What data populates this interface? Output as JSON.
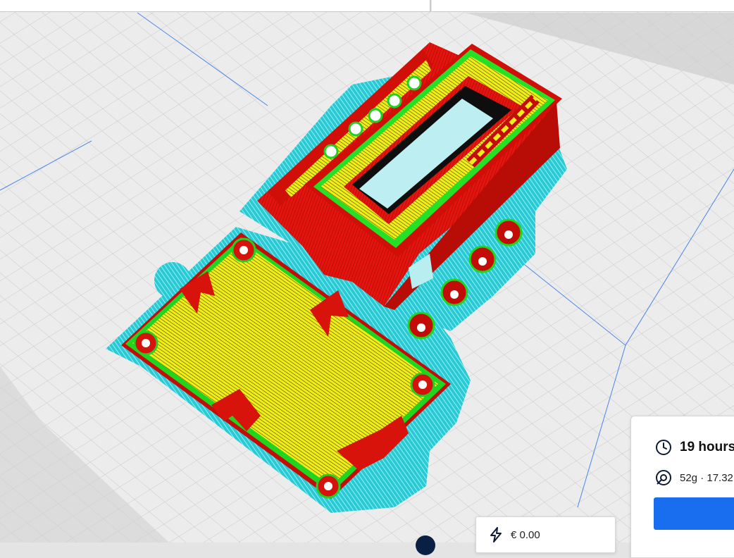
{
  "estimate": {
    "cost": "€ 0.00",
    "print_time": "19 hours",
    "material": "52g · 17.32"
  },
  "slice_button": {
    "label": ""
  },
  "colors": {
    "accent": "#196ef0",
    "plate_grid": "#e4e4e4",
    "support": "#4fe0e6",
    "wall": "#e8120c",
    "infill": "#f2ef1a",
    "inner_wall": "#22e022"
  },
  "icons": {
    "cost": "lightning-icon",
    "time": "clock-icon",
    "material": "spool-icon"
  }
}
